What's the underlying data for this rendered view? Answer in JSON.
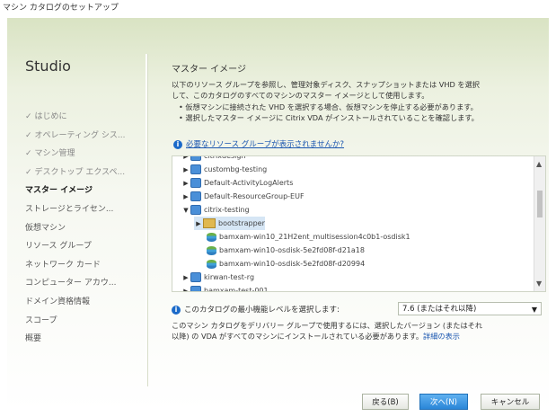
{
  "window": {
    "title": "マシン カタログのセットアップ"
  },
  "sidebar": {
    "studio": "Studio",
    "items": [
      {
        "label": "はじめに",
        "state": "done"
      },
      {
        "label": "オペレーティング シス...",
        "state": "done"
      },
      {
        "label": "マシン管理",
        "state": "done"
      },
      {
        "label": "デスクトップ エクスペ...",
        "state": "done"
      },
      {
        "label": "マスター イメージ",
        "state": "active"
      },
      {
        "label": "ストレージとライセン...",
        "state": "pending"
      },
      {
        "label": "仮想マシン",
        "state": "pending"
      },
      {
        "label": "リソース グループ",
        "state": "pending"
      },
      {
        "label": "ネットワーク カード",
        "state": "pending"
      },
      {
        "label": "コンピューター アカウ...",
        "state": "pending"
      },
      {
        "label": "ドメイン資格情報",
        "state": "pending"
      },
      {
        "label": "スコープ",
        "state": "pending"
      },
      {
        "label": "概要",
        "state": "pending"
      }
    ],
    "check": "✓"
  },
  "main": {
    "title": "マスター イメージ",
    "desc1": "以下のリソース グループを参照し、管理対象ディスク、スナップショットまたは VHD を選択",
    "desc2": "して、このカタログのすべてのマシンのマスター イメージとして使用します。",
    "bullet1": "• 仮想マシンに接続された VHD を選択する場合、仮想マシンを停止する必要があります。",
    "bullet2": "• 選択したマスター イメージに Citrix VDA がインストールされていることを確認します。",
    "help_link": "必要なリソース グループが表示されませんか?",
    "tree": [
      "citrixdesign",
      "custombg-testing",
      "Default-ActivityLogAlerts",
      "Default-ResourceGroup-EUF",
      "citrix-testing",
      "bootstrapper",
      "bamxam-win10_21H2ent_multisession4c0b1-osdisk1",
      "bamxam-win10-osdisk-5e2fd08f-d21a18",
      "bamxam-win10-osdisk-5e2fd08f-d20994",
      "kirwan-test-rg",
      "bamxam-test-001"
    ],
    "level_label": "このカタログの最小機能レベルを選択します:",
    "level_value": "7.6 (またはそれ以降)",
    "note1": "このマシン カタログをデリバリー グループで使用するには、選択したバージョン (またはそれ",
    "note2": "以降) の VDA がすべてのマシンにインストールされている必要があります。",
    "details_link": "詳細の表示"
  },
  "buttons": {
    "back": "戻る(B)",
    "next": "次へ(N)",
    "cancel": "キャンセル"
  }
}
